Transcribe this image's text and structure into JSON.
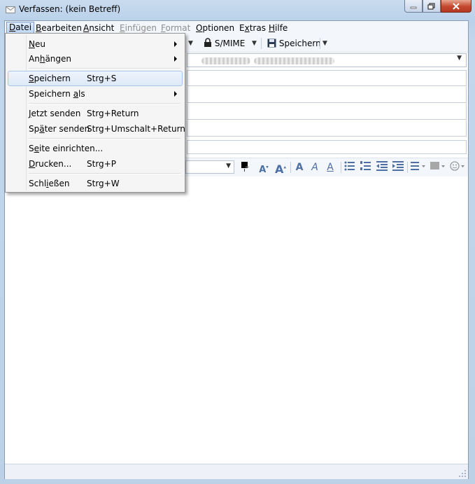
{
  "window": {
    "title": "Verfassen: (kein Betreff)",
    "caption_buttons": [
      "minimize",
      "maximize",
      "close"
    ]
  },
  "menubar": {
    "items": [
      {
        "label": "Datei",
        "mnemonic": "D"
      },
      {
        "label": "Bearbeiten",
        "mnemonic": "B"
      },
      {
        "label": "Ansicht",
        "mnemonic": "A"
      },
      {
        "label": "Einfügen",
        "mnemonic": "E"
      },
      {
        "label": "Format",
        "mnemonic": "F"
      },
      {
        "label": "Optionen",
        "mnemonic": "O"
      },
      {
        "label": "Extras",
        "mnemonic": "x"
      },
      {
        "label": "Hilfe",
        "mnemonic": "H"
      }
    ]
  },
  "toolbar": {
    "smime_label": "S/MIME",
    "save_label": "Speichern"
  },
  "file_menu": {
    "items": [
      {
        "pre": "",
        "u": "N",
        "post": "eu",
        "shortcut": "",
        "submenu": true
      },
      {
        "pre": "An",
        "u": "h",
        "post": "ängen",
        "shortcut": "",
        "submenu": true
      },
      {
        "pre": "",
        "u": "S",
        "post": "peichern",
        "shortcut": "Strg+S",
        "submenu": false
      },
      {
        "pre": "Speichern ",
        "u": "a",
        "post": "ls",
        "shortcut": "",
        "submenu": true
      },
      {
        "pre": "",
        "u": "J",
        "post": "etzt senden",
        "shortcut": "Strg+Return",
        "submenu": false
      },
      {
        "pre": "Sp",
        "u": "ä",
        "post": "ter senden",
        "shortcut": "Strg+Umschalt+Return",
        "submenu": false
      },
      {
        "pre": "S",
        "u": "e",
        "post": "ite einrichten...",
        "shortcut": "",
        "submenu": false
      },
      {
        "pre": "",
        "u": "D",
        "post": "rucken...",
        "shortcut": "Strg+P",
        "submenu": false
      },
      {
        "pre": "Schl",
        "u": "i",
        "post": "eßen",
        "shortcut": "Strg+W",
        "submenu": false
      }
    ]
  },
  "colors": {
    "frame": "#bcd0e6",
    "menu_highlight": "#dde9f8",
    "icon_blue": "#4d6fa3"
  }
}
